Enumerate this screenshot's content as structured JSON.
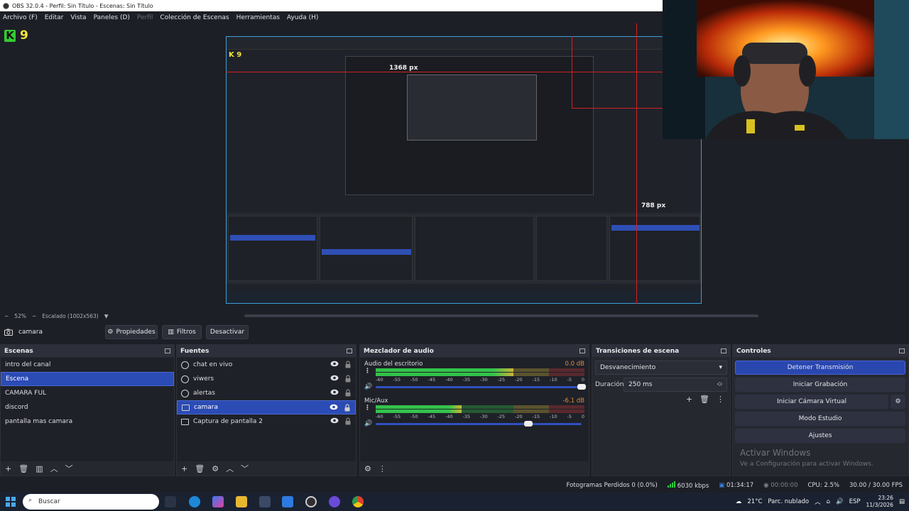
{
  "window": {
    "title": "OBS 32.0.4 - Perfil: Sin Título - Escenas: Sin Título"
  },
  "menu": [
    {
      "label": "Archivo (F)",
      "enabled": true
    },
    {
      "label": "Editar",
      "enabled": true
    },
    {
      "label": "Vista",
      "enabled": true
    },
    {
      "label": "Paneles (D)",
      "enabled": true
    },
    {
      "label": "Perfil",
      "enabled": false
    },
    {
      "label": "Colección de Escenas",
      "enabled": true
    },
    {
      "label": "Herramientas",
      "enabled": true
    },
    {
      "label": "Ayuda (H)",
      "enabled": true
    }
  ],
  "preview": {
    "overlay_number": "9",
    "guide_labels": {
      "horizontal": "1368 px",
      "vertical": "788 px"
    },
    "zoom": "52%",
    "scaling": "Escalado (1002x563)"
  },
  "source_toolbar": {
    "source_name": "camara",
    "properties": "Propiedades",
    "filters": "Filtros",
    "deactivate": "Desactivar"
  },
  "scenes": {
    "title": "Escenas",
    "items": [
      "intro del canal",
      "Escena",
      "CAMARA FUL",
      "discord",
      "pantalla mas camara"
    ],
    "selected_index": 1
  },
  "sources": {
    "title": "Fuentes",
    "items": [
      {
        "label": "chat en vivo",
        "icon": "globe-icon"
      },
      {
        "label": "viwers",
        "icon": "globe-icon"
      },
      {
        "label": "alertas",
        "icon": "globe-icon"
      },
      {
        "label": "camara",
        "icon": "camera-icon"
      },
      {
        "label": "Captura de pantalla 2",
        "icon": "monitor-icon"
      }
    ],
    "selected_index": 3
  },
  "mixer": {
    "title": "Mezclador de audio",
    "ticks": [
      "-60",
      "-55",
      "-50",
      "-45",
      "-40",
      "-35",
      "-30",
      "-25",
      "-20",
      "-15",
      "-10",
      "-5",
      "0"
    ],
    "tracks": [
      {
        "name": "Audio del escritorio",
        "db": "0.0 dB",
        "level_fraction": 0.66,
        "fader_fraction": 1.0
      },
      {
        "name": "Mic/Aux",
        "db": "-6.1 dB",
        "level_fraction": 0.41,
        "fader_fraction": 0.74
      }
    ]
  },
  "transitions": {
    "title": "Transiciones de escena",
    "selected": "Desvanecimiento",
    "duration_label": "Duración",
    "duration_value": "250 ms"
  },
  "controls": {
    "title": "Controles",
    "stop_stream": "Detener Transmisión",
    "start_recording": "Iniciar Grabación",
    "virtual_camera": "Iniciar Cámara Virtual",
    "studio_mode": "Modo Estudio",
    "settings": "Ajustes"
  },
  "watermark": {
    "title": "Activar Windows",
    "subtitle": "Ve a Configuración para activar Windows."
  },
  "status": {
    "dropped_frames": "Fotogramas Perdidos 0 (0.0%)",
    "bitrate": "6030 kbps",
    "stream_time": "01:34:17",
    "rec_time": "00:00:00",
    "cpu": "CPU: 2.5%",
    "fps": "30.00 / 30.00 FPS"
  },
  "taskbar": {
    "search_placeholder": "Buscar",
    "weather_temp": "21°C",
    "weather_desc": "Parc. nublado",
    "lang": "ESP",
    "time": "23:26",
    "date": "11/3/2026"
  },
  "colors": {
    "accent": "#2b4bb5",
    "meter_green": "#33c24a",
    "meter_yellow": "#c9b33a",
    "meter_red": "#c23a3a",
    "guide_red": "#d42020"
  }
}
